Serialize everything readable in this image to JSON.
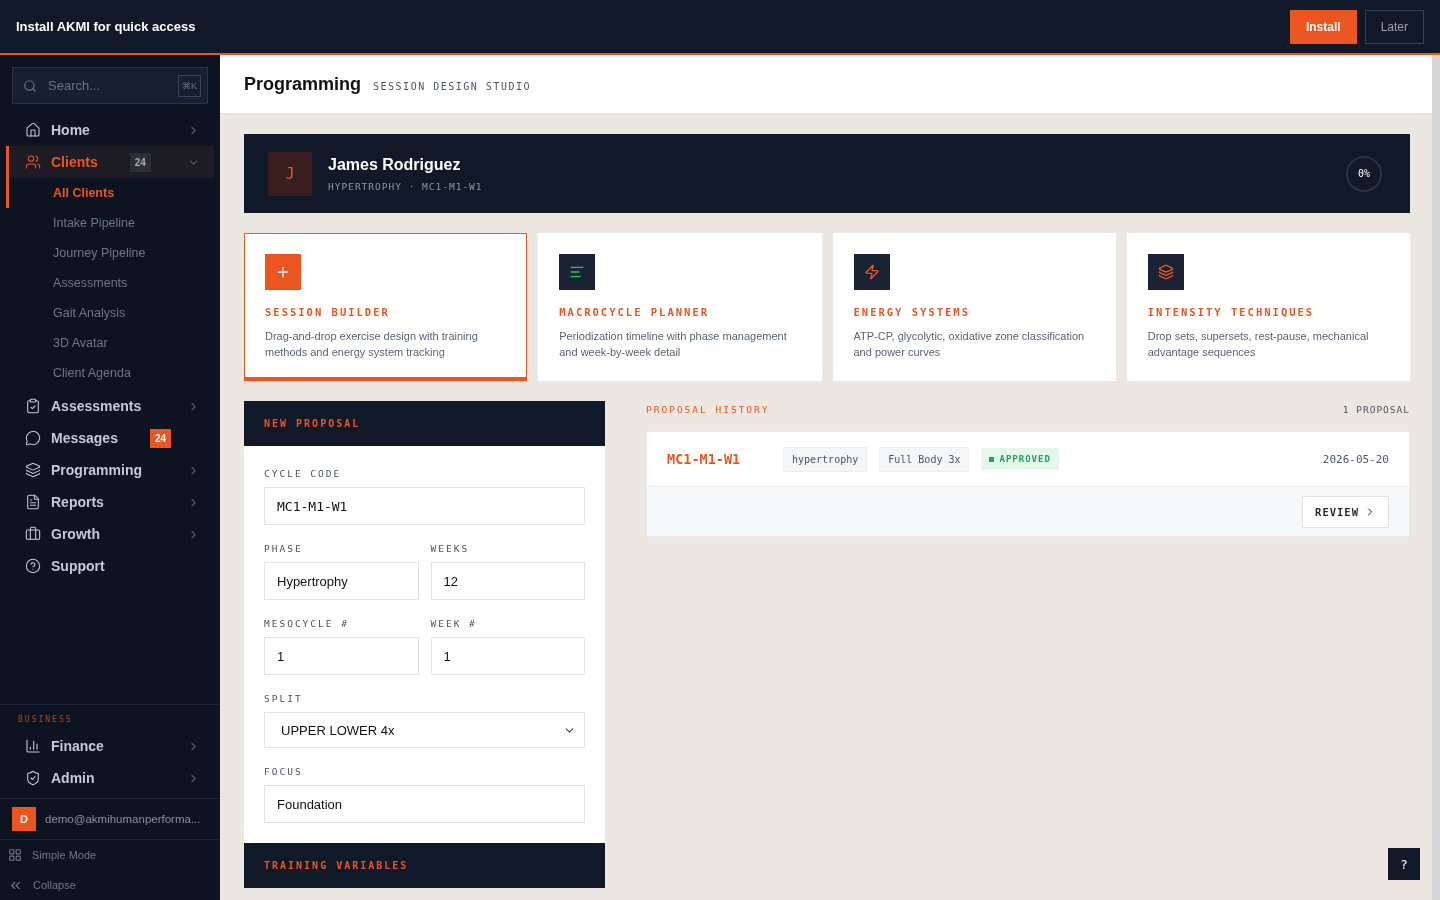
{
  "install_banner": {
    "text": "Install AKMI for quick access",
    "install": "Install",
    "later": "Later"
  },
  "sidebar": {
    "search": {
      "placeholder": "Search...",
      "shortcut": "⌘K"
    },
    "items": [
      {
        "label": "Home",
        "selected": false,
        "expanded": false
      },
      {
        "label": "Clients",
        "selected": true,
        "expanded": true,
        "badge": {
          "text": "24",
          "kind": "count"
        },
        "children": [
          {
            "label": "All Clients",
            "selected": true
          },
          {
            "label": "Intake Pipeline",
            "selected": false
          },
          {
            "label": "Journey Pipeline",
            "selected": false
          },
          {
            "label": "Assessments",
            "selected": false
          },
          {
            "label": "Gait Analysis",
            "selected": false
          },
          {
            "label": "3D Avatar",
            "selected": false
          },
          {
            "label": "Client Agenda",
            "selected": false
          }
        ]
      },
      {
        "label": "Assessments",
        "selected": false,
        "expanded": false
      },
      {
        "label": "Messages",
        "selected": false,
        "badge": {
          "text": "24",
          "kind": "alert"
        }
      },
      {
        "label": "Programming",
        "selected": false,
        "expanded": false
      },
      {
        "label": "Reports",
        "selected": false,
        "expanded": false
      },
      {
        "label": "Growth",
        "selected": false,
        "expanded": false
      },
      {
        "label": "Support",
        "selected": false
      }
    ],
    "section_title": "BUSINESS",
    "business_items": [
      {
        "label": "Finance",
        "selected": false,
        "expanded": false
      },
      {
        "label": "Admin",
        "selected": false,
        "expanded": false
      }
    ],
    "user": {
      "initial": "D",
      "email": "demo@akmihumanperforma..."
    },
    "footer": [
      "Simple Mode",
      "Collapse"
    ]
  },
  "header": {
    "title": "Programming",
    "subtitle": "SESSION DESIGN STUDIO"
  },
  "client": {
    "initial": "J",
    "name": "James Rodriguez",
    "meta": "HYPERTROPHY · MC1-M1-W1",
    "progress": {
      "reading": "0%"
    }
  },
  "tools": [
    {
      "title": "SESSION BUILDER",
      "description": "Drag-and-drop exercise design with training methods and energy system tracking",
      "selected": true
    },
    {
      "title": "MACROCYCLE PLANNER",
      "description": "Periodization timeline with phase management and week-by-week detail",
      "selected": false
    },
    {
      "title": "ENERGY SYSTEMS",
      "description": "ATP-CP, glycolytic, oxidative zone classification and power curves",
      "selected": false
    },
    {
      "title": "INTENSITY TECHNIQUES",
      "description": "Drop sets, supersets, rest-pause, mechanical advantage sequences",
      "selected": false
    }
  ],
  "new_proposal": {
    "title": "NEW PROPOSAL",
    "rows": [
      [
        {
          "label": "CYCLE CODE",
          "value": "MC1-M1-W1",
          "kind": "text",
          "mono": true
        }
      ],
      [
        {
          "label": "PHASE",
          "value": "Hypertrophy",
          "kind": "text"
        },
        {
          "label": "WEEKS",
          "value": "12",
          "kind": "text"
        }
      ],
      [
        {
          "label": "MESOCYCLE #",
          "value": "1",
          "kind": "text"
        },
        {
          "label": "WEEK #",
          "value": "1",
          "kind": "text"
        }
      ],
      [
        {
          "label": "SPLIT",
          "value": "UPPER LOWER 4x",
          "kind": "select"
        }
      ],
      [
        {
          "label": "FOCUS",
          "value": "Foundation",
          "kind": "text"
        }
      ]
    ],
    "next_section": "TRAINING VARIABLES"
  },
  "proposal_history": {
    "title": "PROPOSAL HISTORY",
    "count": "1 PROPOSAL",
    "proposals": [
      {
        "code": "MC1-M1-W1",
        "tags": [
          "hypertrophy",
          "Full Body 3x"
        ],
        "status": {
          "text": "APPROVED",
          "kind": "approved"
        },
        "date": "2026-05-20",
        "action": "REVIEW"
      }
    ]
  },
  "help": "?"
}
